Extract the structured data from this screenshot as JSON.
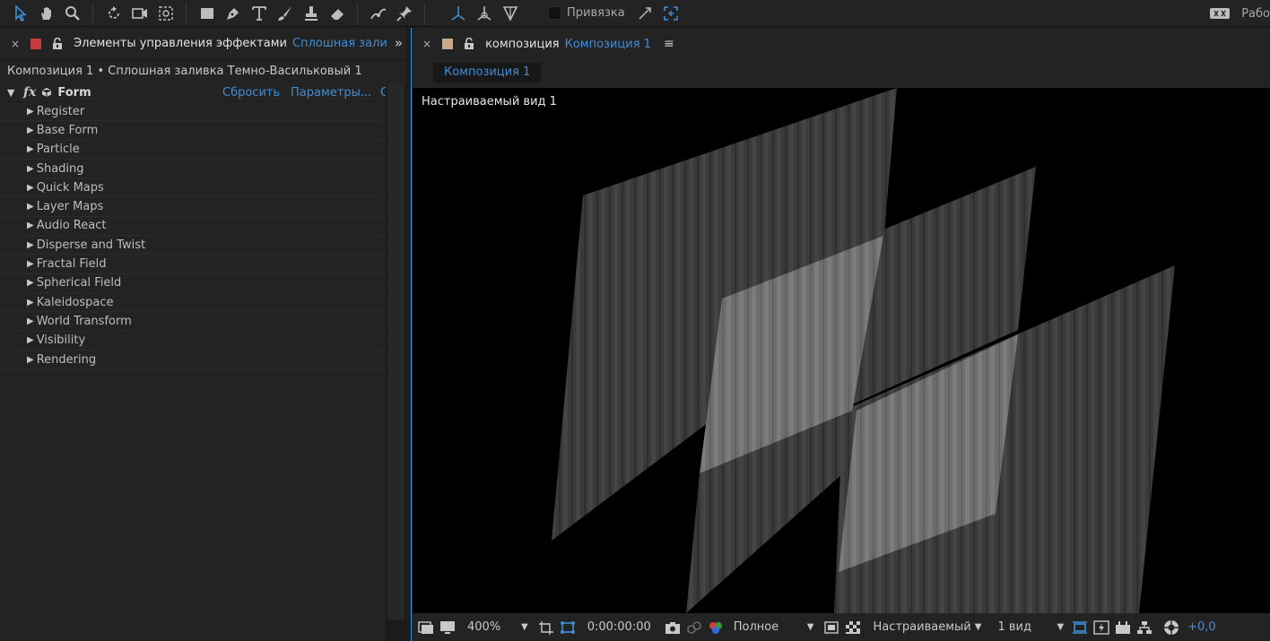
{
  "toolbar": {
    "tools": [
      "selection-tool-icon",
      "hand-tool-icon",
      "zoom-tool-icon",
      "rotate-tool-icon",
      "camera-tool-icon",
      "pan-behind-tool-icon",
      "rectangle-tool-icon",
      "pen-tool-icon",
      "type-tool-icon",
      "brush-tool-icon",
      "clone-stamp-tool-icon",
      "eraser-tool-icon",
      "roto-brush-tool-icon",
      "puppet-pin-tool-icon"
    ],
    "snap_label": "Привязка",
    "workspace_label": "Рабо"
  },
  "effects_panel": {
    "title": "Элементы управления эффектами",
    "title_link": "Сплошная зали",
    "breadcrumb": "Композиция 1 • Сплошная заливка Темно-Васильковый 1",
    "effect": {
      "fx_badge": "fx",
      "name": "Form",
      "reset_label": "Сбросить",
      "options_label": "Параметры...",
      "about_label": "О"
    },
    "groups": [
      {
        "label": "Register"
      },
      {
        "label": "Base Form"
      },
      {
        "label": "Particle"
      },
      {
        "label": "Shading"
      },
      {
        "label": "Quick Maps"
      },
      {
        "label": "Layer Maps"
      },
      {
        "label": "Audio React"
      },
      {
        "label": "Disperse and Twist"
      },
      {
        "label": "Fractal Field"
      },
      {
        "label": "Spherical Field"
      },
      {
        "label": "Kaleidospace"
      },
      {
        "label": "World Transform"
      },
      {
        "label": "Visibility"
      },
      {
        "label": "Rendering"
      }
    ]
  },
  "comp_panel": {
    "title": "композиция",
    "title_link": "Композиция 1",
    "subtab": "Композиция 1",
    "view_label": "Настраиваемый вид 1",
    "viewer_bar": {
      "zoom": "400%",
      "timecode": "0:00:00:00",
      "resolution": "Полное",
      "view": "Настраиваемый",
      "views_count": "1 вид",
      "exposure": "+0,0"
    }
  },
  "colors": {
    "accent": "#3e8fd9",
    "panel_bg": "#232323",
    "label_red": "#c33b3b",
    "label_tan": "#c9a98a"
  }
}
